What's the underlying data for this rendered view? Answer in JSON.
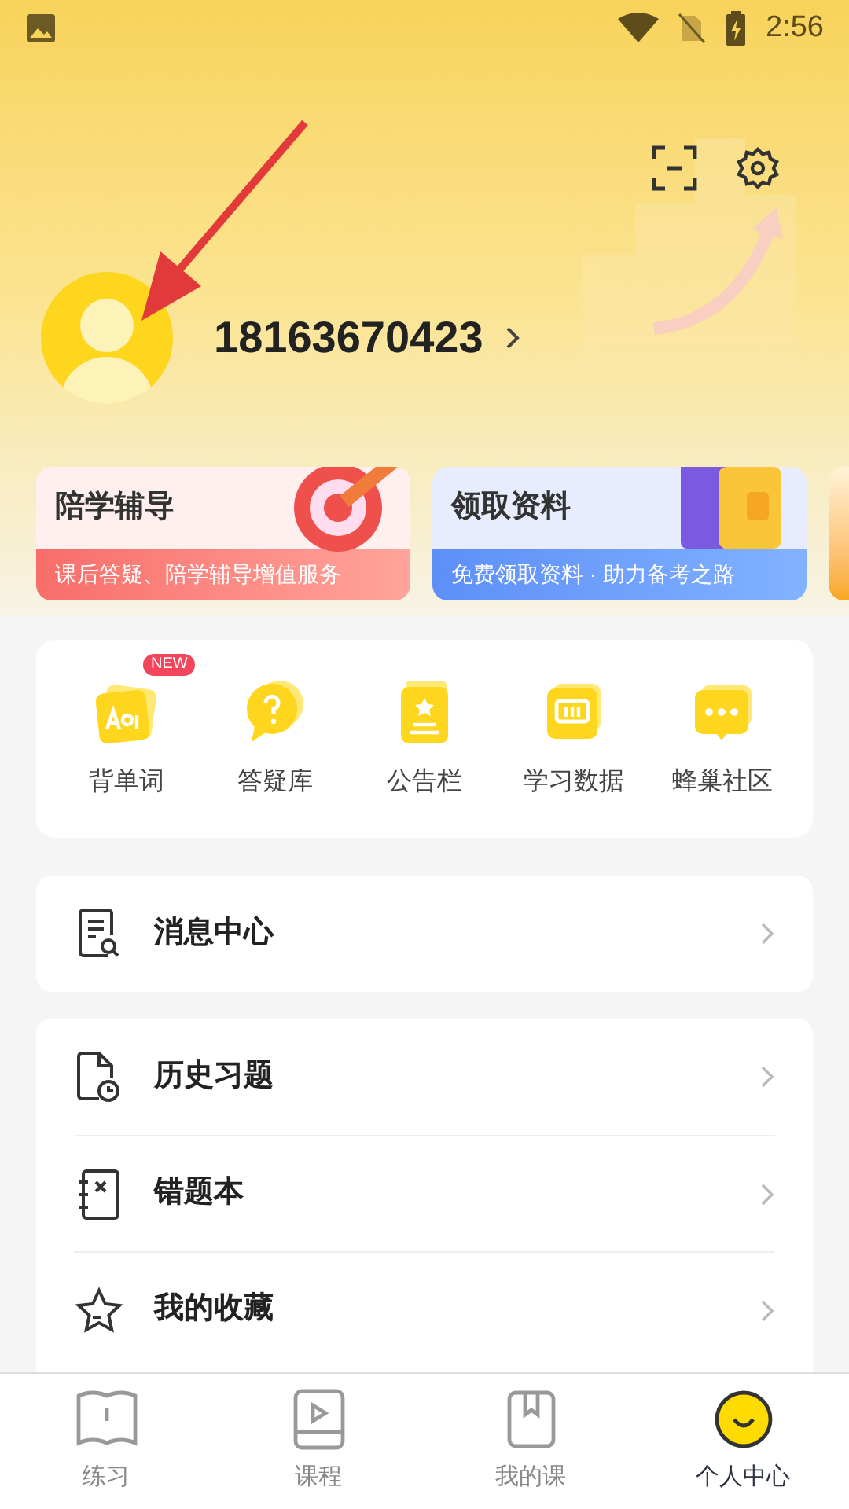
{
  "status_bar": {
    "time": "2:56"
  },
  "profile": {
    "phone": "18163670423"
  },
  "banners": [
    {
      "kind": "tutoring",
      "title": "陪学辅导",
      "subtitle": "课后答疑、陪学辅导增值服务"
    },
    {
      "kind": "materials",
      "title": "领取资料",
      "subtitle": "免费领取资料 · 助力备考之路"
    }
  ],
  "shortcuts": [
    {
      "kind": "words",
      "label": "背单词",
      "badge": "NEW"
    },
    {
      "kind": "qa",
      "label": "答疑库"
    },
    {
      "kind": "notice",
      "label": "公告栏"
    },
    {
      "kind": "data",
      "label": "学习数据"
    },
    {
      "kind": "community",
      "label": "蜂巢社区"
    }
  ],
  "menu_groups": [
    [
      {
        "kind": "message",
        "label": "消息中心"
      }
    ],
    [
      {
        "kind": "history",
        "label": "历史习题"
      },
      {
        "kind": "mistakes",
        "label": "错题本"
      },
      {
        "kind": "favorites",
        "label": "我的收藏"
      }
    ]
  ],
  "tabs": [
    {
      "kind": "practice",
      "label": "练习",
      "selected": false
    },
    {
      "kind": "course",
      "label": "课程",
      "selected": false
    },
    {
      "kind": "mycourse",
      "label": "我的课",
      "selected": false
    },
    {
      "kind": "me",
      "label": "个人中心",
      "selected": true
    }
  ]
}
